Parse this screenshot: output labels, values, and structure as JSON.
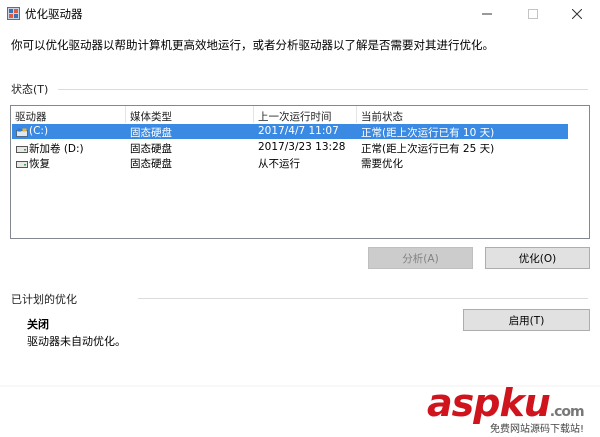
{
  "window": {
    "title": "优化驱动器",
    "intro": "你可以优化驱动器以帮助计算机更高效地运行，或者分析驱动器以了解是否需要对其进行优化。"
  },
  "status": {
    "label": "状态(T)",
    "columns": [
      "驱动器",
      "媒体类型",
      "上一次运行时间",
      "当前状态"
    ],
    "drives": [
      {
        "name": "(C:)",
        "media": "固态硬盘",
        "last_run": "2017/4/7 11:07",
        "status": "正常(距上次运行已有 10 天)",
        "icon": "system-drive-icon",
        "selected": true
      },
      {
        "name": "新加卷 (D:)",
        "media": "固态硬盘",
        "last_run": "2017/3/23 13:28",
        "status": "正常(距上次运行已有 25 天)",
        "icon": "drive-icon",
        "selected": false
      },
      {
        "name": "恢复",
        "media": "固态硬盘",
        "last_run": "从不运行",
        "status": "需要优化",
        "icon": "drive-icon",
        "selected": false
      }
    ],
    "analyze_button": "分析(A)",
    "optimize_button": "优化(O)"
  },
  "schedule": {
    "label": "已计划的优化",
    "state": "关闭",
    "description": "驱动器未自动优化。",
    "enable_button": "启用(T)"
  },
  "watermark": {
    "brand": "aspku",
    "tld": ".com",
    "tagline": "免费网站源码下载站!"
  },
  "colors": {
    "selection": "#3a8ae3",
    "watermark": "#d0141e"
  }
}
